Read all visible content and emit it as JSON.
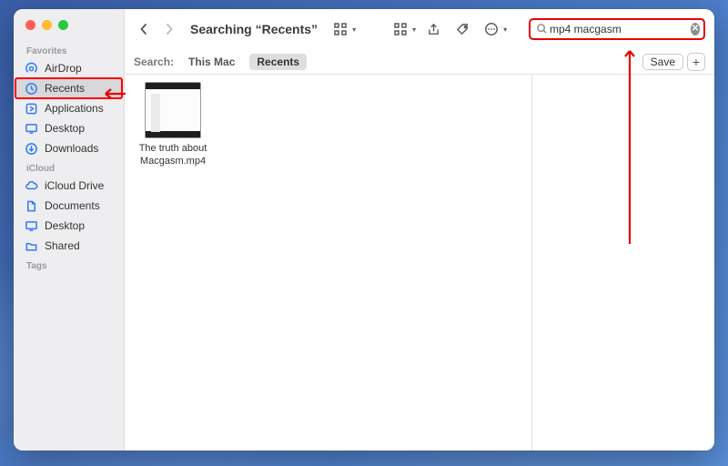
{
  "colors": {
    "annotation": "#e60000",
    "sidebar_icon": "#2f7bf6"
  },
  "window_title": "Searching “Recents”",
  "search": {
    "value": "mp4 macgasm",
    "placeholder": "Search"
  },
  "scopebar": {
    "label": "Search:",
    "scopes": [
      "This Mac",
      "Recents"
    ],
    "active_index": 1,
    "save_label": "Save",
    "plus_label": "+"
  },
  "sidebar": {
    "sections": [
      {
        "title": "Favorites",
        "items": [
          {
            "icon": "airdrop-icon",
            "label": "AirDrop"
          },
          {
            "icon": "recents-icon",
            "label": "Recents",
            "selected": true,
            "highlighted": true
          },
          {
            "icon": "applications-icon",
            "label": "Applications"
          },
          {
            "icon": "desktop-icon",
            "label": "Desktop"
          },
          {
            "icon": "downloads-icon",
            "label": "Downloads"
          }
        ]
      },
      {
        "title": "iCloud",
        "items": [
          {
            "icon": "icloud-icon",
            "label": "iCloud Drive"
          },
          {
            "icon": "documents-icon",
            "label": "Documents"
          },
          {
            "icon": "desktop-icon",
            "label": "Desktop"
          },
          {
            "icon": "shared-icon",
            "label": "Shared"
          }
        ]
      },
      {
        "title": "Tags",
        "items": []
      }
    ]
  },
  "results": [
    {
      "name": "The truth about Macgasm.mp4"
    }
  ]
}
